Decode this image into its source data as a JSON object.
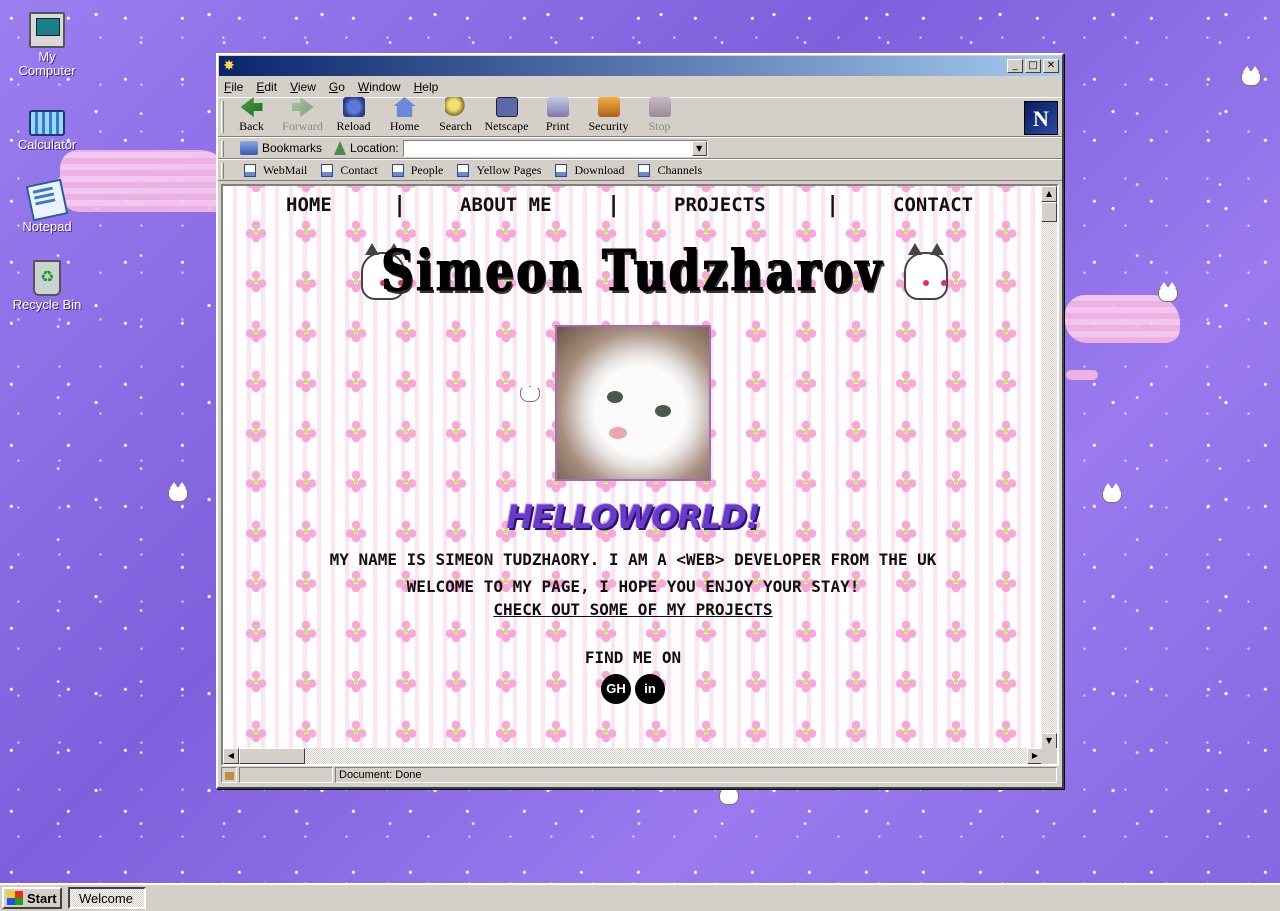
{
  "desktop": {
    "icons": [
      {
        "label_line1": "My",
        "label_line2": "Computer"
      },
      {
        "label_line1": "Calculator",
        "label_line2": ""
      },
      {
        "label_line1": "Notepad",
        "label_line2": ""
      },
      {
        "label_line1": "Recycle Bin",
        "label_line2": ""
      }
    ]
  },
  "browser": {
    "menu": [
      "File",
      "Edit",
      "View",
      "Go",
      "Window",
      "Help"
    ],
    "toolbar": [
      "Back",
      "Forward",
      "Reload",
      "Home",
      "Search",
      "Netscape",
      "Print",
      "Security",
      "Stop"
    ],
    "logo": "N",
    "location": {
      "bookmarks_label": "Bookmarks",
      "label": "Location:",
      "value": ""
    },
    "links": [
      "WebMail",
      "Contact",
      "People",
      "Yellow Pages",
      "Download",
      "Channels"
    ],
    "status": "Document: Done"
  },
  "page": {
    "nav": [
      "Home",
      "About Me",
      "Projects",
      "Contact"
    ],
    "separator": "|",
    "title": "Simeon Tudzharov",
    "hello": "HelloWorld!",
    "intro_line1": "My name is Simeon Tudzhaory. I am a <web> developer from the UK",
    "intro_line2": "Welcome to my page, I hope you enjoy your stay!",
    "projects_link": "Check out some of my projects",
    "find_me": "Find me on",
    "social": {
      "github": "GH",
      "linkedin": "in"
    }
  },
  "taskbar": {
    "start": "Start",
    "task": "Welcome"
  },
  "colors": {
    "desktop": "#8a6ae0",
    "accent_purple": "#6a3ac8",
    "titlebar": "#0a246a",
    "photo_border": "#a66ab8"
  }
}
